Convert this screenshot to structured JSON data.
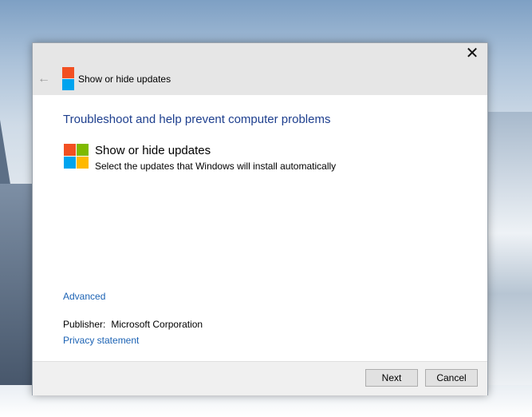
{
  "window": {
    "title": "Show or hide updates",
    "close_glyph": "✕",
    "back_glyph": "←"
  },
  "content": {
    "heading": "Troubleshoot and help prevent computer problems",
    "item_title": "Show or hide updates",
    "item_description": "Select the updates that Windows will install automatically",
    "advanced_link": "Advanced",
    "publisher_label": "Publisher:",
    "publisher_value": "Microsoft Corporation",
    "privacy_link": "Privacy statement"
  },
  "footer": {
    "next_label": "Next",
    "cancel_label": "Cancel"
  },
  "icons": {
    "back": "back-arrow-icon",
    "close": "close-icon",
    "logo": "windows-logo-icon"
  },
  "colors": {
    "heading": "#1e3f8e",
    "link": "#1b62b4",
    "logo_red": "#f25022",
    "logo_green": "#7fba00",
    "logo_blue": "#00a4ef",
    "logo_yellow": "#ffb900"
  }
}
